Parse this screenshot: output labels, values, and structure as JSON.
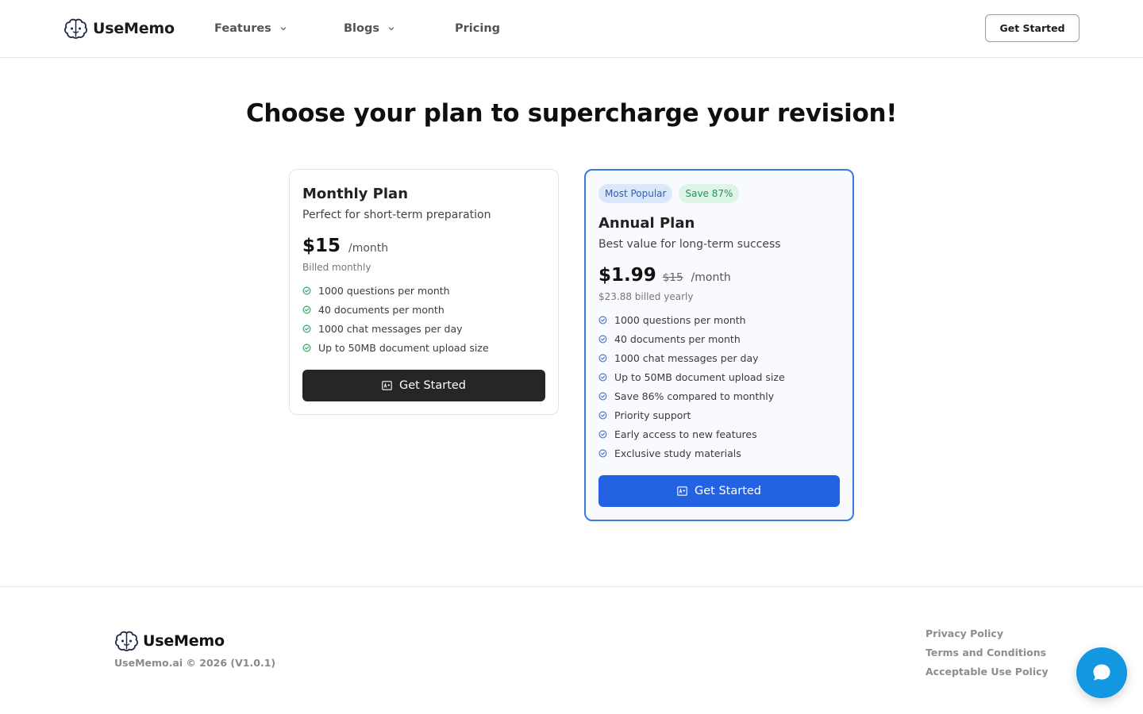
{
  "header": {
    "brand": "UseMemo",
    "nav": {
      "features": "Features",
      "blogs": "Blogs",
      "pricing": "Pricing"
    },
    "cta": "Get Started"
  },
  "page": {
    "title": "Choose your plan to supercharge your revision!"
  },
  "plans": {
    "monthly": {
      "name": "Monthly Plan",
      "description": "Perfect for short-term preparation",
      "price": "$15",
      "period": "/month",
      "billing": "Billed monthly",
      "features": [
        "1000 questions per month",
        "40 documents per month",
        "1000 chat messages per day",
        "Up to 50MB document upload size"
      ],
      "button": "Get Started"
    },
    "annual": {
      "badge_popular": "Most Popular",
      "badge_save": "Save 87%",
      "name": "Annual Plan",
      "description": "Best value for long-term success",
      "price": "$1.99",
      "old_price": "$15",
      "period": "/month",
      "billing": "$23.88 billed yearly",
      "features": [
        "1000 questions per month",
        "40 documents per month",
        "1000 chat messages per day",
        "Up to 50MB document upload size",
        "Save 86% compared to monthly",
        "Priority support",
        "Early access to new features",
        "Exclusive study materials"
      ],
      "button": "Get Started"
    }
  },
  "footer": {
    "brand": "UseMemo",
    "copyright": "UseMemo.ai © 2026 (V1.0.1)",
    "links": {
      "privacy": "Privacy Policy",
      "terms": "Terms and Conditions",
      "acceptable_use": "Acceptable Use Policy"
    }
  },
  "icons": {
    "logo": "brain-icon",
    "nav_chevron": "chevron-down-icon",
    "feature_check": "check-circle-icon",
    "button_icon": "grade-card-icon",
    "chat": "chat-bubble-icon"
  },
  "colors": {
    "accent_blue": "#2462e4",
    "annual_border": "#3a7be0",
    "check_green": "#2e9a5e",
    "check_blue": "#3b6fd6",
    "dark_button": "#262626",
    "chat_fab": "#1297e0"
  }
}
